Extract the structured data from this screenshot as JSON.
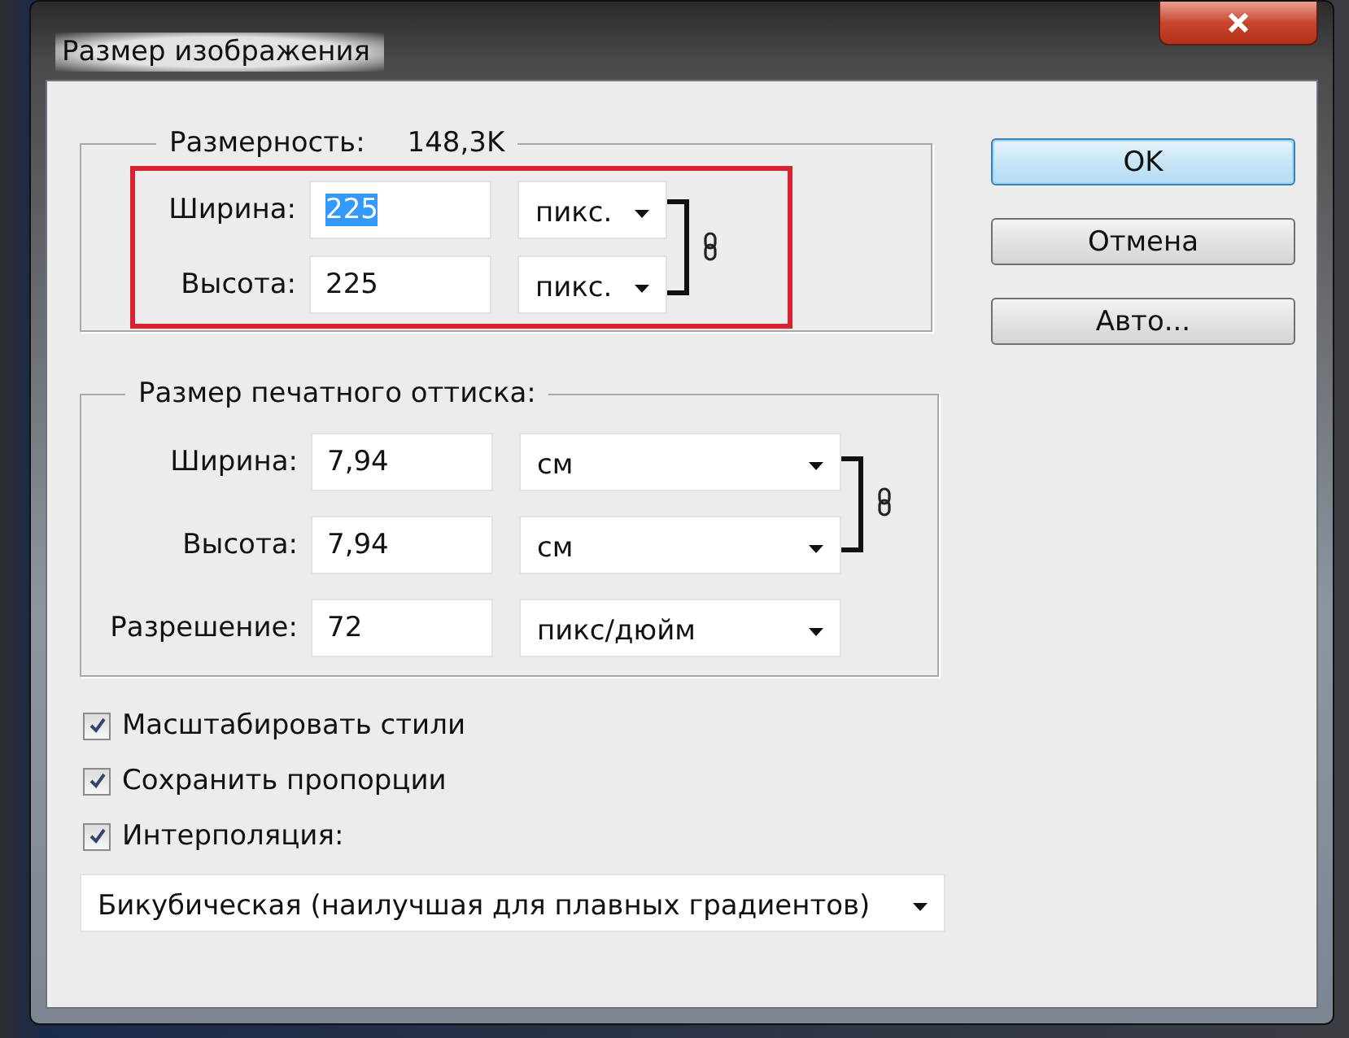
{
  "window": {
    "title": "Размер изображения"
  },
  "pixel_dimensions": {
    "label": "Размерность:",
    "value": "148,3K",
    "highlighted": true,
    "rows": [
      {
        "label": "Ширина:",
        "value": "225",
        "text_selected": true,
        "unit": "пикс."
      },
      {
        "label": "Высота:",
        "value": "225",
        "text_selected": false,
        "unit": "пикс."
      }
    ]
  },
  "document_size": {
    "title": "Размер печатного оттиска:",
    "rows": [
      {
        "label": "Ширина:",
        "value": "7,94",
        "unit": "см"
      },
      {
        "label": "Высота:",
        "value": "7,94",
        "unit": "см"
      },
      {
        "label": "Разрешение:",
        "value": "72",
        "unit": "пикс/дюйм"
      }
    ]
  },
  "buttons": [
    {
      "label": "OK",
      "default": true
    },
    {
      "label": "Отмена",
      "default": false
    },
    {
      "label": "Авто...",
      "default": false
    }
  ],
  "checkboxes": [
    {
      "label": "Масштабировать стили",
      "checked": true
    },
    {
      "label": "Сохранить пропорции",
      "checked": true
    },
    {
      "label": "Интерполяция:",
      "checked": true
    }
  ],
  "interpolation": {
    "value": "Бикубическая (наилучшая для плавных градиентов)"
  }
}
